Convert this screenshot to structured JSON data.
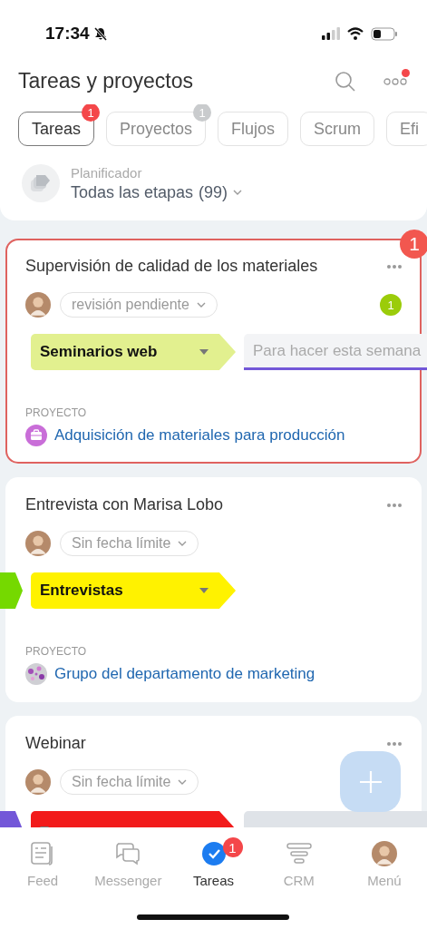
{
  "status_bar": {
    "time": "17:34"
  },
  "header": {
    "title": "Tareas y proyectos",
    "has_notification": true
  },
  "tabs": [
    {
      "label": "Tareas",
      "selected": true,
      "badge": "1"
    },
    {
      "label": "Proyectos",
      "selected": false,
      "badge": "1"
    },
    {
      "label": "Flujos",
      "selected": false
    },
    {
      "label": "Scrum",
      "selected": false
    },
    {
      "label": "Efi",
      "selected": false
    }
  ],
  "planner": {
    "label": "Planificador",
    "value": "Todas las etapas",
    "count": "(99)"
  },
  "tasks": [
    {
      "title": "Supervisión de calidad de los materiales",
      "highlighted": true,
      "badge": "1",
      "deadline": "revisión pendiente",
      "comments": "1",
      "stages": [
        {
          "kind": "current",
          "label": "Seminarios web",
          "color": "#e2f08f"
        },
        {
          "kind": "next",
          "label": "Para hacer esta semana",
          "color": "#7357d8"
        }
      ],
      "project_label": "PROYECTO",
      "project": "Adquisición de materiales para producción"
    },
    {
      "title": "Entrevista con Marisa Lobo",
      "highlighted": false,
      "deadline": "Sin fecha límite",
      "stages": [
        {
          "kind": "previous",
          "color": "#75d900"
        },
        {
          "kind": "current",
          "label": "Entrevistas",
          "color": "#fff200"
        }
      ],
      "project_label": "PROYECTO",
      "project": "Grupo del departamento de marketing"
    },
    {
      "title": "Webinar",
      "highlighted": false,
      "deadline": "Sin fecha límite",
      "stages": [
        {
          "kind": "previous",
          "color": "#7357d8"
        },
        {
          "kind": "current",
          "color": "#f21b1b"
        },
        {
          "kind": "next",
          "color": "#dfe3e8"
        }
      ]
    }
  ],
  "nav": [
    {
      "label": "Feed",
      "selected": false
    },
    {
      "label": "Messenger",
      "selected": false
    },
    {
      "label": "Tareas",
      "selected": true,
      "badge": "1"
    },
    {
      "label": "CRM",
      "selected": false
    },
    {
      "label": "Menú",
      "selected": false
    }
  ]
}
